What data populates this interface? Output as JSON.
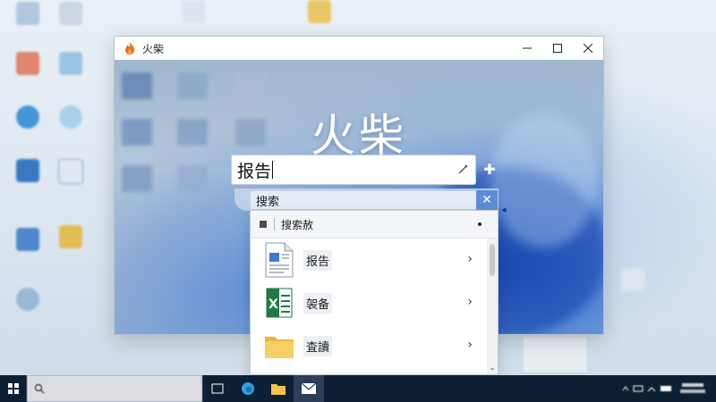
{
  "window": {
    "title": "火柴",
    "minimize_icon": "minimize-icon",
    "maximize_icon": "maximize-icon",
    "close_icon": "close-icon"
  },
  "app": {
    "heading": "火柴"
  },
  "search": {
    "value": "报告",
    "edit_icon": "pencil-icon",
    "add_icon": "plus-icon"
  },
  "popup": {
    "header_label": "搜索",
    "close_glyph": "✕",
    "subheader_label": "搜索赦",
    "items": [
      {
        "label": "报告",
        "icon": "document-icon"
      },
      {
        "label": "袈备",
        "icon": "spreadsheet-icon"
      },
      {
        "label": "査讀",
        "icon": "folder-icon"
      }
    ]
  },
  "colors": {
    "accent": "#5b8fd6",
    "taskbar": "#0d1f33",
    "heading": "#ffffff"
  }
}
